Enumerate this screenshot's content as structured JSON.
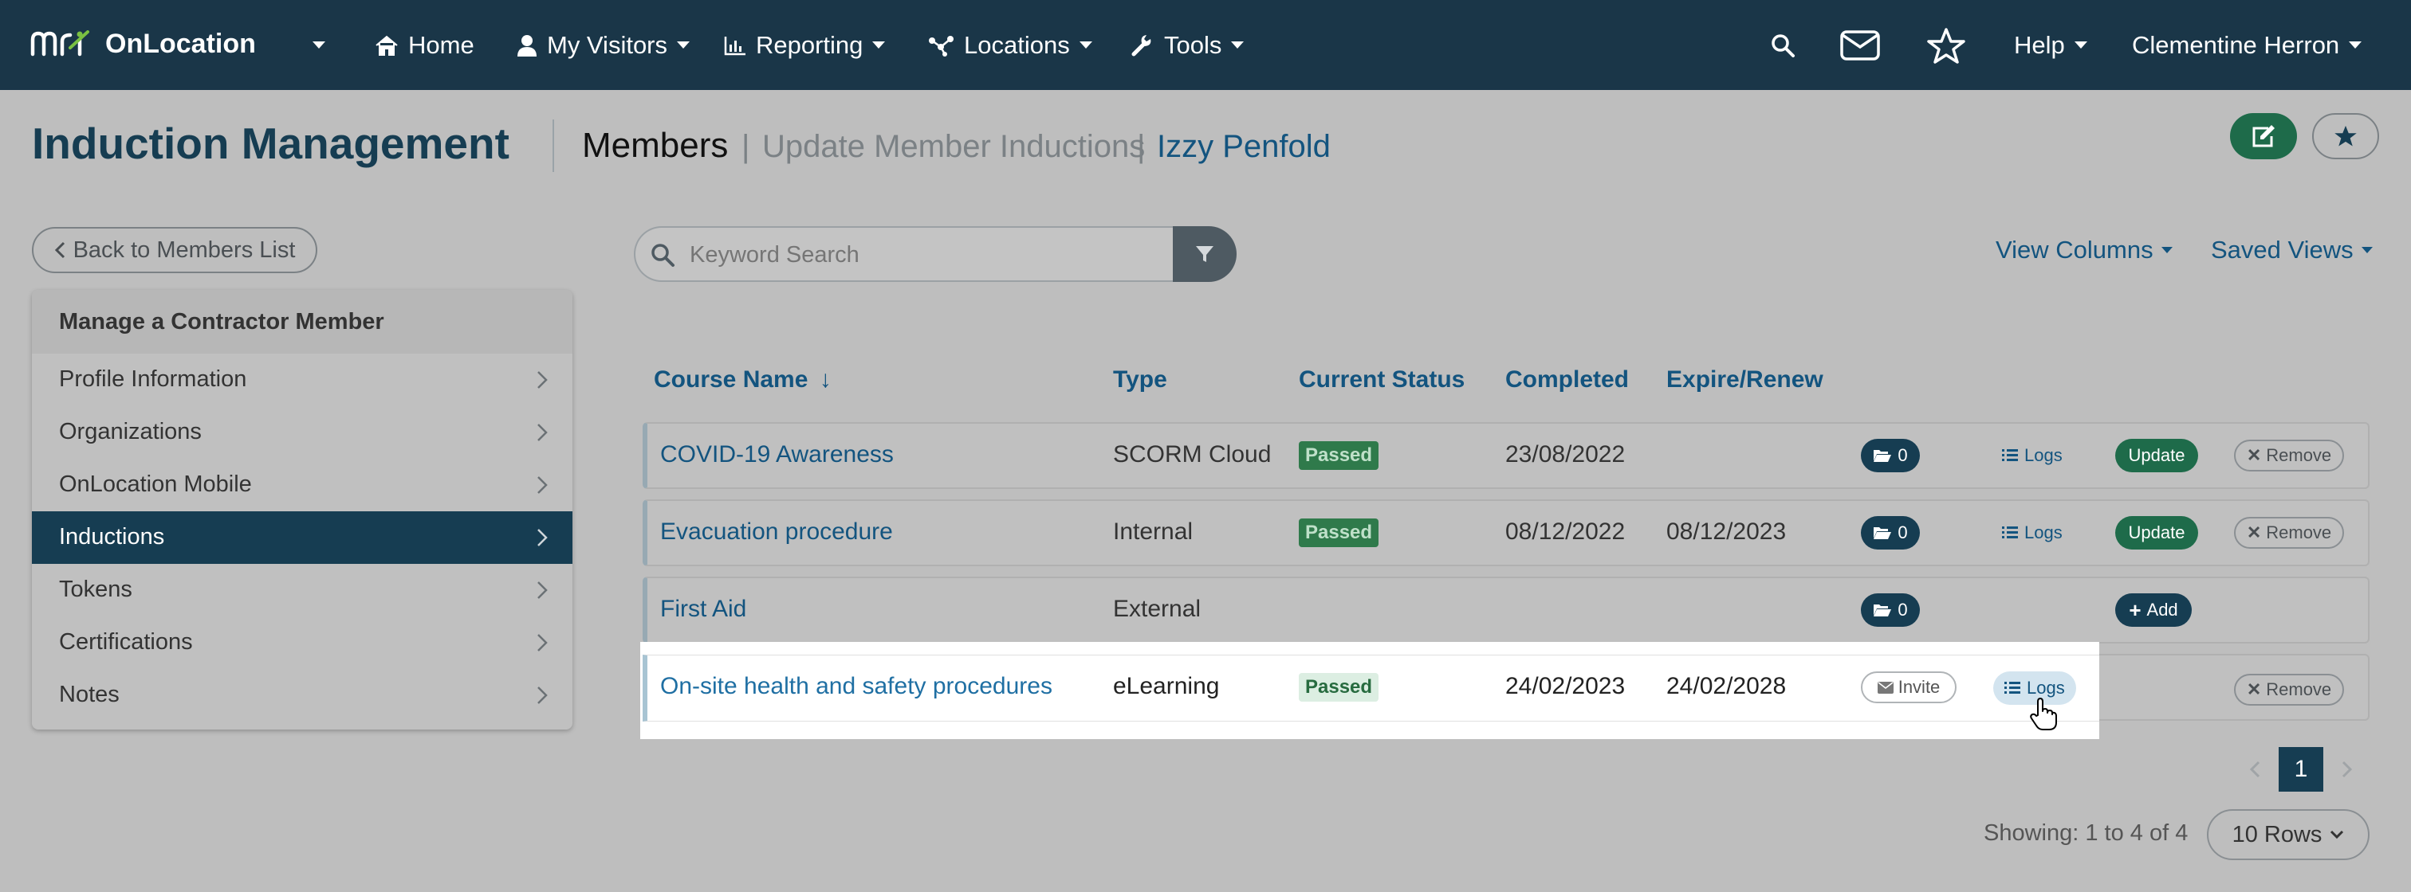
{
  "app": {
    "brand": "OnLocation"
  },
  "nav": {
    "home": "Home",
    "visitors": "My Visitors",
    "reporting": "Reporting",
    "locations": "Locations",
    "tools": "Tools",
    "help": "Help",
    "user": "Clementine Herron"
  },
  "header": {
    "title": "Induction Management",
    "breadcrumb": [
      "Members",
      "Update Member Inductions",
      "Izzy Penfold"
    ],
    "separator": "|"
  },
  "toolbar": {
    "back_label": "Back to Members List",
    "search_placeholder": "Keyword Search",
    "view_columns": "View Columns",
    "saved_views": "Saved Views"
  },
  "sidebar": {
    "heading": "Manage a Contractor Member",
    "items": [
      {
        "label": "Profile Information"
      },
      {
        "label": "Organizations"
      },
      {
        "label": "OnLocation Mobile"
      },
      {
        "label": "Inductions",
        "active": true
      },
      {
        "label": "Tokens"
      },
      {
        "label": "Certifications"
      },
      {
        "label": "Notes"
      }
    ]
  },
  "table": {
    "columns": [
      "Course Name",
      "Type",
      "Current Status",
      "Completed",
      "Expire/Renew"
    ],
    "sort_indicator": "↓",
    "rows": [
      {
        "course": "COVID-19 Awareness",
        "type": "SCORM Cloud",
        "status": "Passed",
        "completed": "23/08/2022",
        "expire": "",
        "files": "0",
        "logs": "Logs",
        "action": "Update",
        "remove": "Remove"
      },
      {
        "course": "Evacuation procedure",
        "type": "Internal",
        "status": "Passed",
        "completed": "08/12/2022",
        "expire": "08/12/2023",
        "files": "0",
        "logs": "Logs",
        "action": "Update",
        "remove": "Remove"
      },
      {
        "course": "First Aid",
        "type": "External",
        "status": "",
        "completed": "",
        "expire": "",
        "files": "0",
        "action": "Add"
      },
      {
        "course": "On-site health and safety procedures",
        "type": "eLearning",
        "status": "Passed",
        "completed": "24/02/2023",
        "expire": "24/02/2028",
        "invite": "Invite",
        "logs": "Logs",
        "remove": "Remove"
      }
    ]
  },
  "pagination": {
    "current_page": "1",
    "showing": "Showing: 1 to 4 of 4",
    "rows_per_page": "10 Rows"
  },
  "colors": {
    "navbar": "#1a3648",
    "accent": "#13547f",
    "active_nav": "#163d52",
    "success": "#2f7a4b",
    "highlight": "#ffffff"
  }
}
